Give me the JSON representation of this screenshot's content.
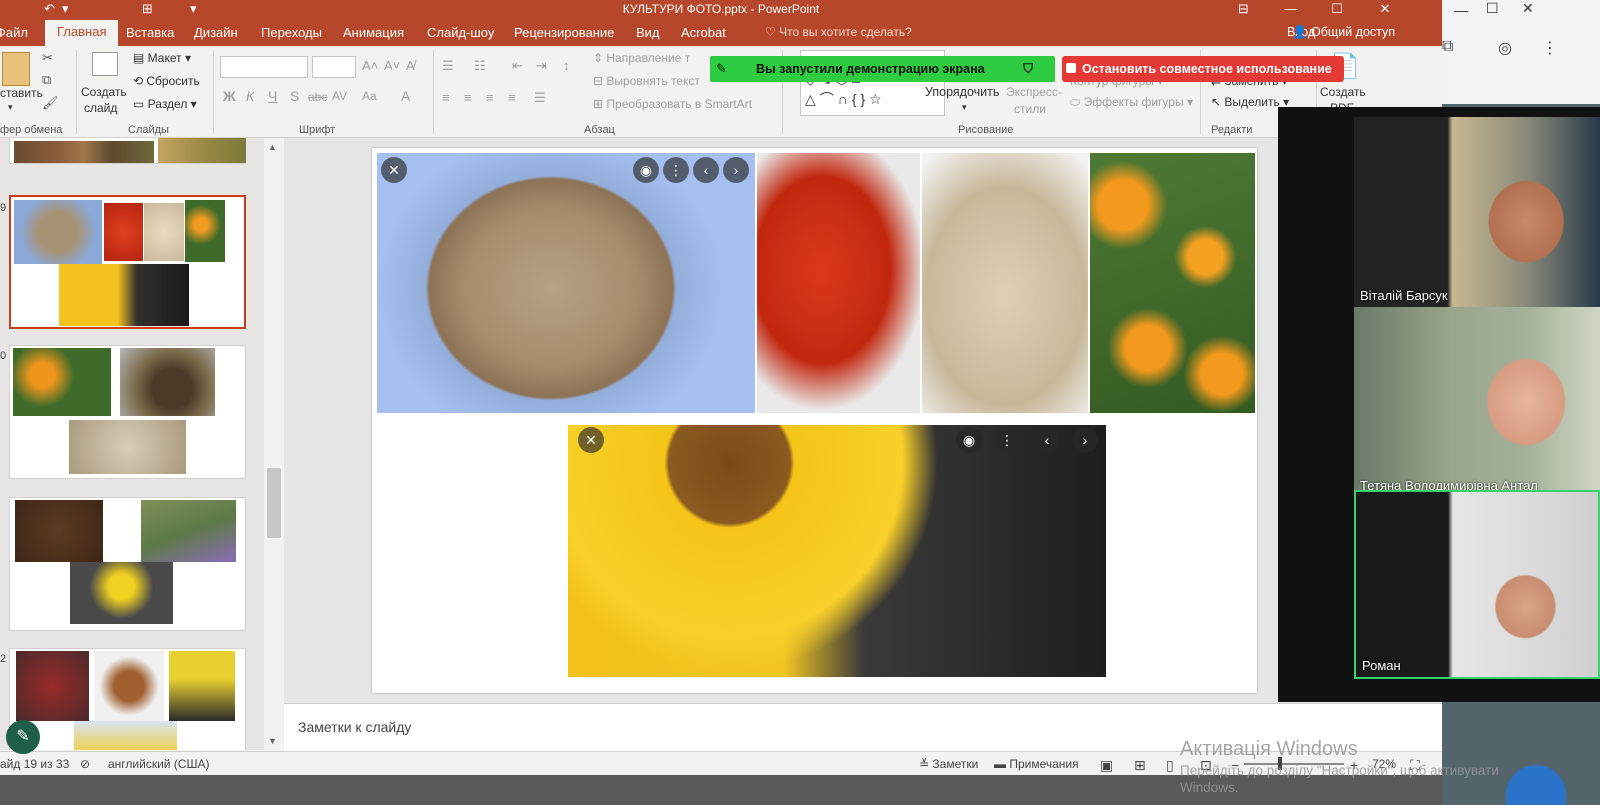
{
  "window": {
    "title": "КУЛЬТУРИ ФОТО.pptx - PowerPoint",
    "min_glyph": "—",
    "max_glyph": "☐",
    "close_glyph": "✕"
  },
  "tabs": [
    "Файл",
    "Главная",
    "Вставка",
    "Дизайн",
    "Переходы",
    "Анимация",
    "Слайд-шоу",
    "Рецензирование",
    "Вид",
    "Acrobat"
  ],
  "active_tab": "Главная",
  "tell_me": "Что вы хотите сделать?",
  "sign_in": "Вход",
  "share": "Общий доступ",
  "ribbon": {
    "paste": "ставить",
    "clipboard_group": "фер обмена",
    "new_slide": "Создать",
    "new_slide2": "слайд",
    "layout": "Макет",
    "reset": "Сбросить",
    "section": "Раздел",
    "slides_group": "Слайды",
    "font_group": "Шрифт",
    "font_chars": [
      "Ж",
      "К",
      "Ч",
      "S",
      "abc",
      "AV",
      "Aa",
      "A"
    ],
    "text_direction": "Направление т",
    "align_text": "Выровнять текст",
    "smartart": "Преобразовать в SmartArt",
    "paragraph_group": "Абзац",
    "arrange": "Упорядочить",
    "quick_styles": "Экспресс-",
    "quick_styles2": "стили",
    "shape_outline": "Контур фигуры",
    "shape_effects": "Эффекты фигуры",
    "drawing_group": "Рисование",
    "replace": "Заменить",
    "select": "Выделить",
    "editing_group": "Редакти",
    "create_pdf": "Создать",
    "create_pdf2": "PDF"
  },
  "screen_share": {
    "status": "Вы запустили демонстрацию экрана",
    "stop": "Остановить совместное использование"
  },
  "thumbnails": [
    {
      "num": "",
      "selected": false
    },
    {
      "num": "9",
      "selected": true
    },
    {
      "num": "0",
      "selected": false
    },
    {
      "num": "",
      "selected": false
    },
    {
      "num": "2",
      "selected": false
    }
  ],
  "notes_placeholder": "Заметки к слайду",
  "status": {
    "slide_info": "айд 19 из 33",
    "language": "английский (США)",
    "notes": "Заметки",
    "comments": "Примечания",
    "zoom": "72%",
    "minus": "−",
    "plus": "+"
  },
  "participants": [
    {
      "name": "Віталій Барсук",
      "active": false
    },
    {
      "name": "Тетяна Володимирівна Антал",
      "active": false
    },
    {
      "name": "Роман",
      "active": true
    }
  ],
  "activation": {
    "line1": "Активація Windows",
    "line2": "Перейдіть до розділу \"Настройки\", щоб активувати",
    "line3": "Windows."
  },
  "colors": {
    "ppt_accent": "#b7472a",
    "share_green": "#2ecc40",
    "share_red": "#e53935",
    "active_speaker": "#36d36e"
  }
}
